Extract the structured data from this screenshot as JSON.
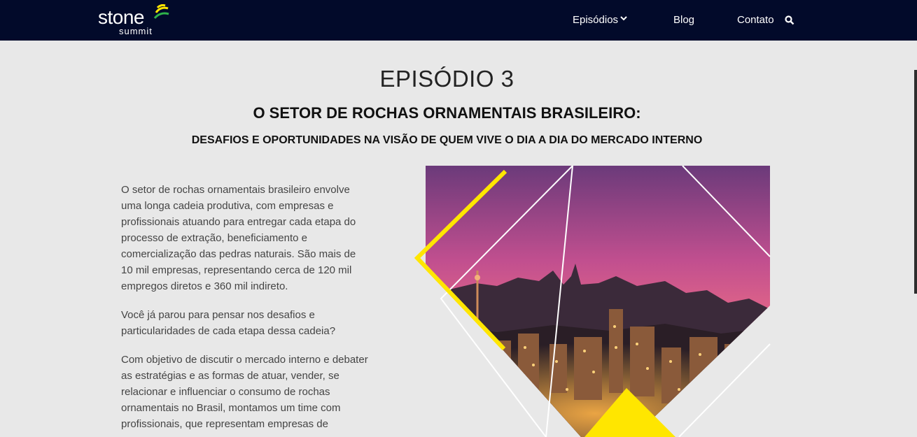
{
  "header": {
    "logo": {
      "main": "stone",
      "sub": "summit"
    },
    "nav": [
      {
        "label": "Episódios",
        "has_dropdown": true
      },
      {
        "label": "Blog"
      },
      {
        "label": "Contato"
      }
    ],
    "search_icon": "search-icon"
  },
  "main": {
    "episode_title": "EPISÓDIO 3",
    "subtitle": "O SETOR DE ROCHAS ORNAMENTAIS BRASILEIRO:",
    "tagline": "DESAFIOS E OPORTUNIDADES NA VISÃO DE QUEM VIVE O DIA A DIA DO MERCADO INTERNO",
    "paragraphs": [
      "O setor de rochas ornamentais brasileiro envolve uma longa cadeia produtiva, com empresas e profissionais atuando para entregar cada etapa do processo de extração, beneficiamento e comercialização das pedras naturais. São mais de 10 mil empresas, representando cerca de 120 mil empregos diretos e 360 mil indireto.",
      "Você já parou para pensar nos desafios e particularidades de cada etapa dessa cadeia?",
      "Com objetivo de discutir o mercado interno e debater as estratégias e as formas de atuar, vender, se relacionar e influenciar o consumo de rochas ornamentais no Brasil, montamos um time com profissionais, que representam empresas de"
    ]
  },
  "colors": {
    "nav_bg": "#020a2a",
    "page_bg": "#e8e8e8",
    "accent_yellow": "#ffe600",
    "logo_arc_green": "#2fb34a"
  }
}
